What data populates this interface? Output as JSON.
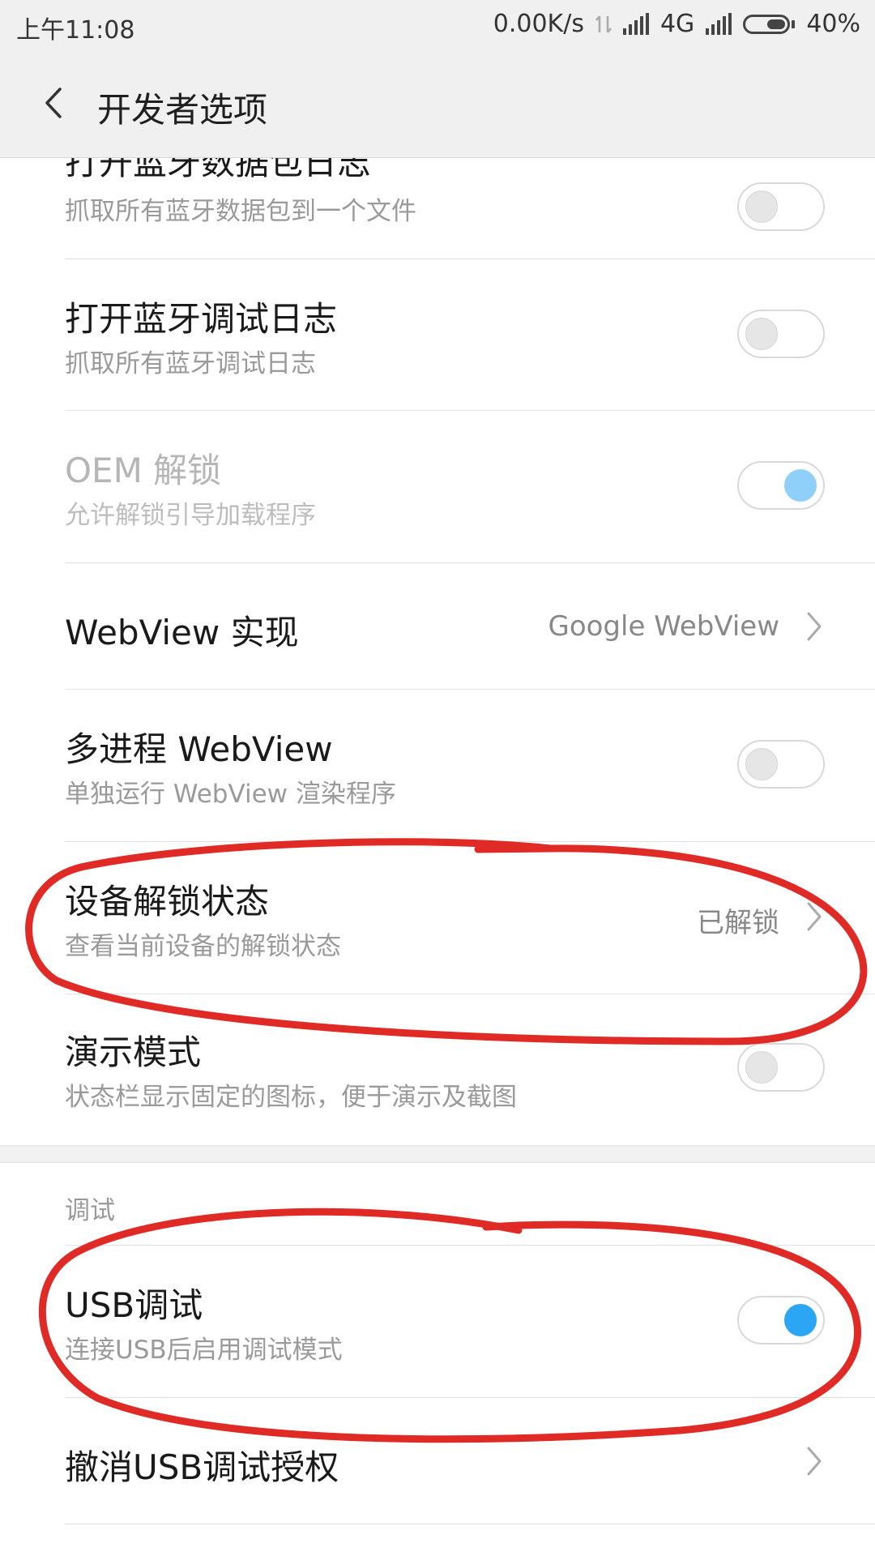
{
  "status_bar": {
    "time": "上午11:08",
    "speed": "0.00K/s",
    "network": "4G",
    "battery": "40%",
    "battery_level": 0.4
  },
  "header": {
    "title": "开发者选项",
    "back_icon": "back-arrow-icon"
  },
  "items": [
    {
      "title": "打开蓝牙数据包日志",
      "subtitle": "抓取所有蓝牙数据包到一个文件",
      "toggle": false
    },
    {
      "title": "打开蓝牙调试日志",
      "subtitle": "抓取所有蓝牙调试日志",
      "toggle": false
    },
    {
      "title": "OEM 解锁",
      "subtitle": "允许解锁引导加载程序",
      "toggle": true,
      "disabled": true
    },
    {
      "title": "WebView 实现",
      "value": "Google WebView"
    },
    {
      "title": "多进程 WebView",
      "subtitle": "单独运行 WebView 渲染程序",
      "toggle": false
    },
    {
      "title": "设备解锁状态",
      "subtitle": "查看当前设备的解锁状态",
      "value": "已解锁"
    },
    {
      "title": "演示模式",
      "subtitle": "状态栏显示固定的图标，便于演示及截图",
      "toggle": false
    }
  ],
  "debug_section": {
    "label": "调试",
    "items": [
      {
        "title": "USB调试",
        "subtitle": "连接USB后启用调试模式",
        "toggle": true
      },
      {
        "title": "撤消USB调试授权"
      }
    ]
  },
  "colors": {
    "accent": "#2aa6f5",
    "annotation": "#e02a26"
  }
}
